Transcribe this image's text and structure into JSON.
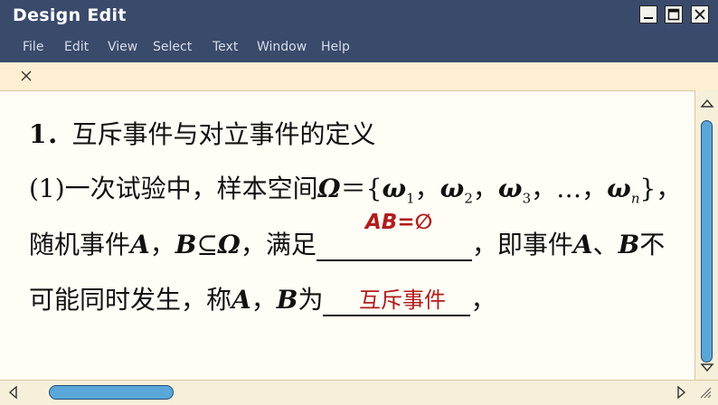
{
  "window": {
    "title": "Design Edit",
    "accent_color": "#3a4a6b",
    "scroll_thumb_color": "#5aa6d8"
  },
  "menu": [
    "File",
    "Edit",
    "View",
    "Select",
    "Text",
    "Window",
    "Help"
  ],
  "tab": {
    "close_glyph": "×"
  },
  "content": {
    "heading_num": "1．",
    "heading_text": "互斥事件与对立事件的定义",
    "line2": {
      "prefix": "(1)一次试验中，样本空间",
      "omega": "Ω",
      "eq": "＝{",
      "w": "ω",
      "s1": "1",
      "s2": "2",
      "s3": "3",
      "sn": "n",
      "sep": "，",
      "ellipsis": "…",
      "close": "}，"
    },
    "line3": {
      "lead": "随机事件",
      "A": "A",
      "comma": "，",
      "B": "B",
      "subset": "⊆",
      "omega": "Ω",
      "satisfy": "，满足",
      "answer1": "AB=∅",
      "after": "，即事件",
      "A2": "A",
      "dun": "、",
      "B2": "B",
      "tail": "不"
    },
    "line4": {
      "lead": "可能同时发生，称",
      "A": "A",
      "comma": "，",
      "B": "B",
      "wei": "为",
      "answer2": "互斥事件",
      "end": "，"
    },
    "answer_color": "#b01d1d"
  }
}
